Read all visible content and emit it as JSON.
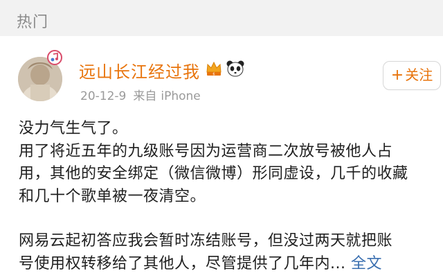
{
  "section": {
    "title": "热门"
  },
  "post": {
    "username": "远山长江经过我",
    "date": "20-12-9",
    "from_label": "来自",
    "source": "iPhone",
    "follow_label": "关注",
    "follow_prefix": "+",
    "lines_para1": [
      "没力气生气了。",
      "用了将近五年的九级账号因为运营商二次放号被他人占",
      "用，其他的安全绑定（微信微博）形同虚设，几千的收藏",
      "和几十个歌单被一夜清空。"
    ],
    "lines_para2": [
      "网易云起初答应我会暂时冻结账号，但没过两天就把账",
      "号使用权转移给了其他人，尽管提供了几年内..."
    ],
    "full_text_label": "全文"
  },
  "icons": {
    "avatar_badge": "music-note-badge-icon",
    "crown": "crown-badge-icon",
    "panda": "panda-emoji-icon"
  },
  "colors": {
    "username": "#e8740c",
    "link": "#3a6fb0",
    "header_bg": "#f2f2f2",
    "meta": "#9a9a9a"
  }
}
